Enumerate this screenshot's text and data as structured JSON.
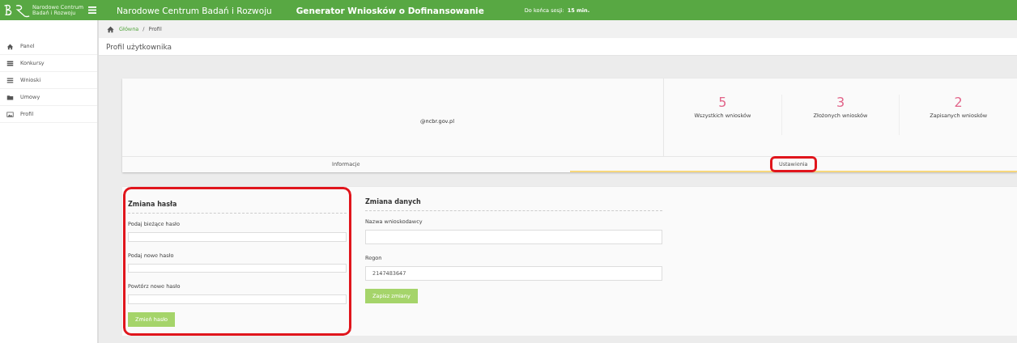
{
  "header": {
    "logo_text": "Narodowe Centrum Badań i Rozwoju",
    "institution": "Narodowe Centrum Badań i Rozwoju",
    "app_title": "Generator Wniosków o Dofinansowanie",
    "session_label": "Do końca sesji:",
    "session_value": "15 min."
  },
  "sidebar": {
    "items": [
      {
        "label": "Panel"
      },
      {
        "label": "Konkursy"
      },
      {
        "label": "Wnioski"
      },
      {
        "label": "Umowy"
      },
      {
        "label": "Profil"
      }
    ]
  },
  "breadcrumb": [
    {
      "label": "Główna",
      "link": true
    },
    {
      "label": "/",
      "link": false
    },
    {
      "label": "Profil",
      "link": false
    }
  ],
  "page_title": "Profil użytkownika",
  "profile": {
    "email": "@ncbr.gov.pl",
    "stats": [
      {
        "value": "5",
        "label": "Wszystkich wniosków"
      },
      {
        "value": "3",
        "label": "Złożonych wniosków"
      },
      {
        "value": "2",
        "label": "Zapisanych wniosków"
      }
    ]
  },
  "tabs": [
    {
      "label": "Informacje",
      "selected": false,
      "highlighted": false
    },
    {
      "label": "Ustawienia",
      "selected": true,
      "highlighted": true
    }
  ],
  "sections": [
    {
      "title": "Zmiana hasła",
      "highlighted": true,
      "fields": [
        {
          "label": "Podaj bieżące hasło"
        },
        {
          "label": "Podaj nowe hasło"
        },
        {
          "label": "Powtórz nowe hasło"
        }
      ],
      "button": "Zmień hasło"
    },
    {
      "title": "Zmiana danych",
      "highlighted": false,
      "fields": [
        {
          "label": "Nazwa wnioskodawcy"
        },
        {
          "label": "Regon",
          "value": "2147483647"
        }
      ],
      "button": "Zapisz zmiany"
    }
  ]
}
